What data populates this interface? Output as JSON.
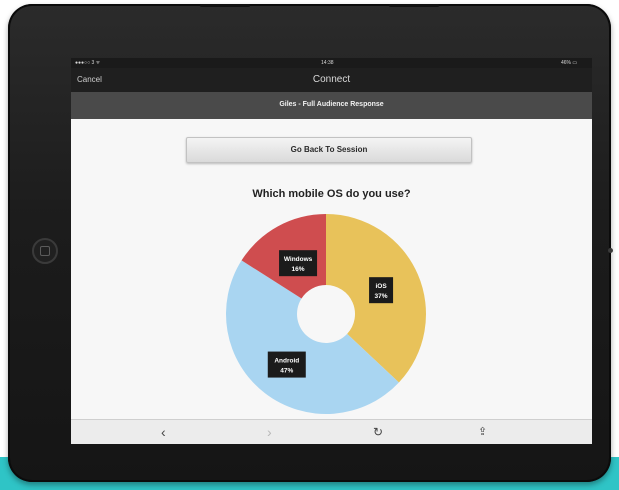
{
  "status_bar": {
    "carrier": "●●●○○ 3 ᯤ",
    "time": "14:38",
    "battery": "46% ▭"
  },
  "nav_bar": {
    "cancel_label": "Cancel",
    "title": "Connect"
  },
  "session_header": {
    "title": "Giles - Full Audience Response"
  },
  "go_back_button": {
    "label": "Go Back To Session"
  },
  "chart_data": {
    "type": "pie",
    "title": "Which mobile OS do you use?",
    "donut": true,
    "slices": [
      {
        "label": "iOS",
        "value": 37,
        "display": "37%",
        "color": "#e8c25a"
      },
      {
        "label": "Android",
        "value": 47,
        "display": "47%",
        "color": "#a9d5f1"
      },
      {
        "label": "Windows",
        "value": 16,
        "display": "16%",
        "color": "#cf4d4f"
      }
    ]
  },
  "toolbar": {
    "back_icon": "chevron-left-icon",
    "forward_icon": "chevron-right-icon",
    "refresh_icon": "refresh-icon",
    "share_icon": "share-icon"
  }
}
